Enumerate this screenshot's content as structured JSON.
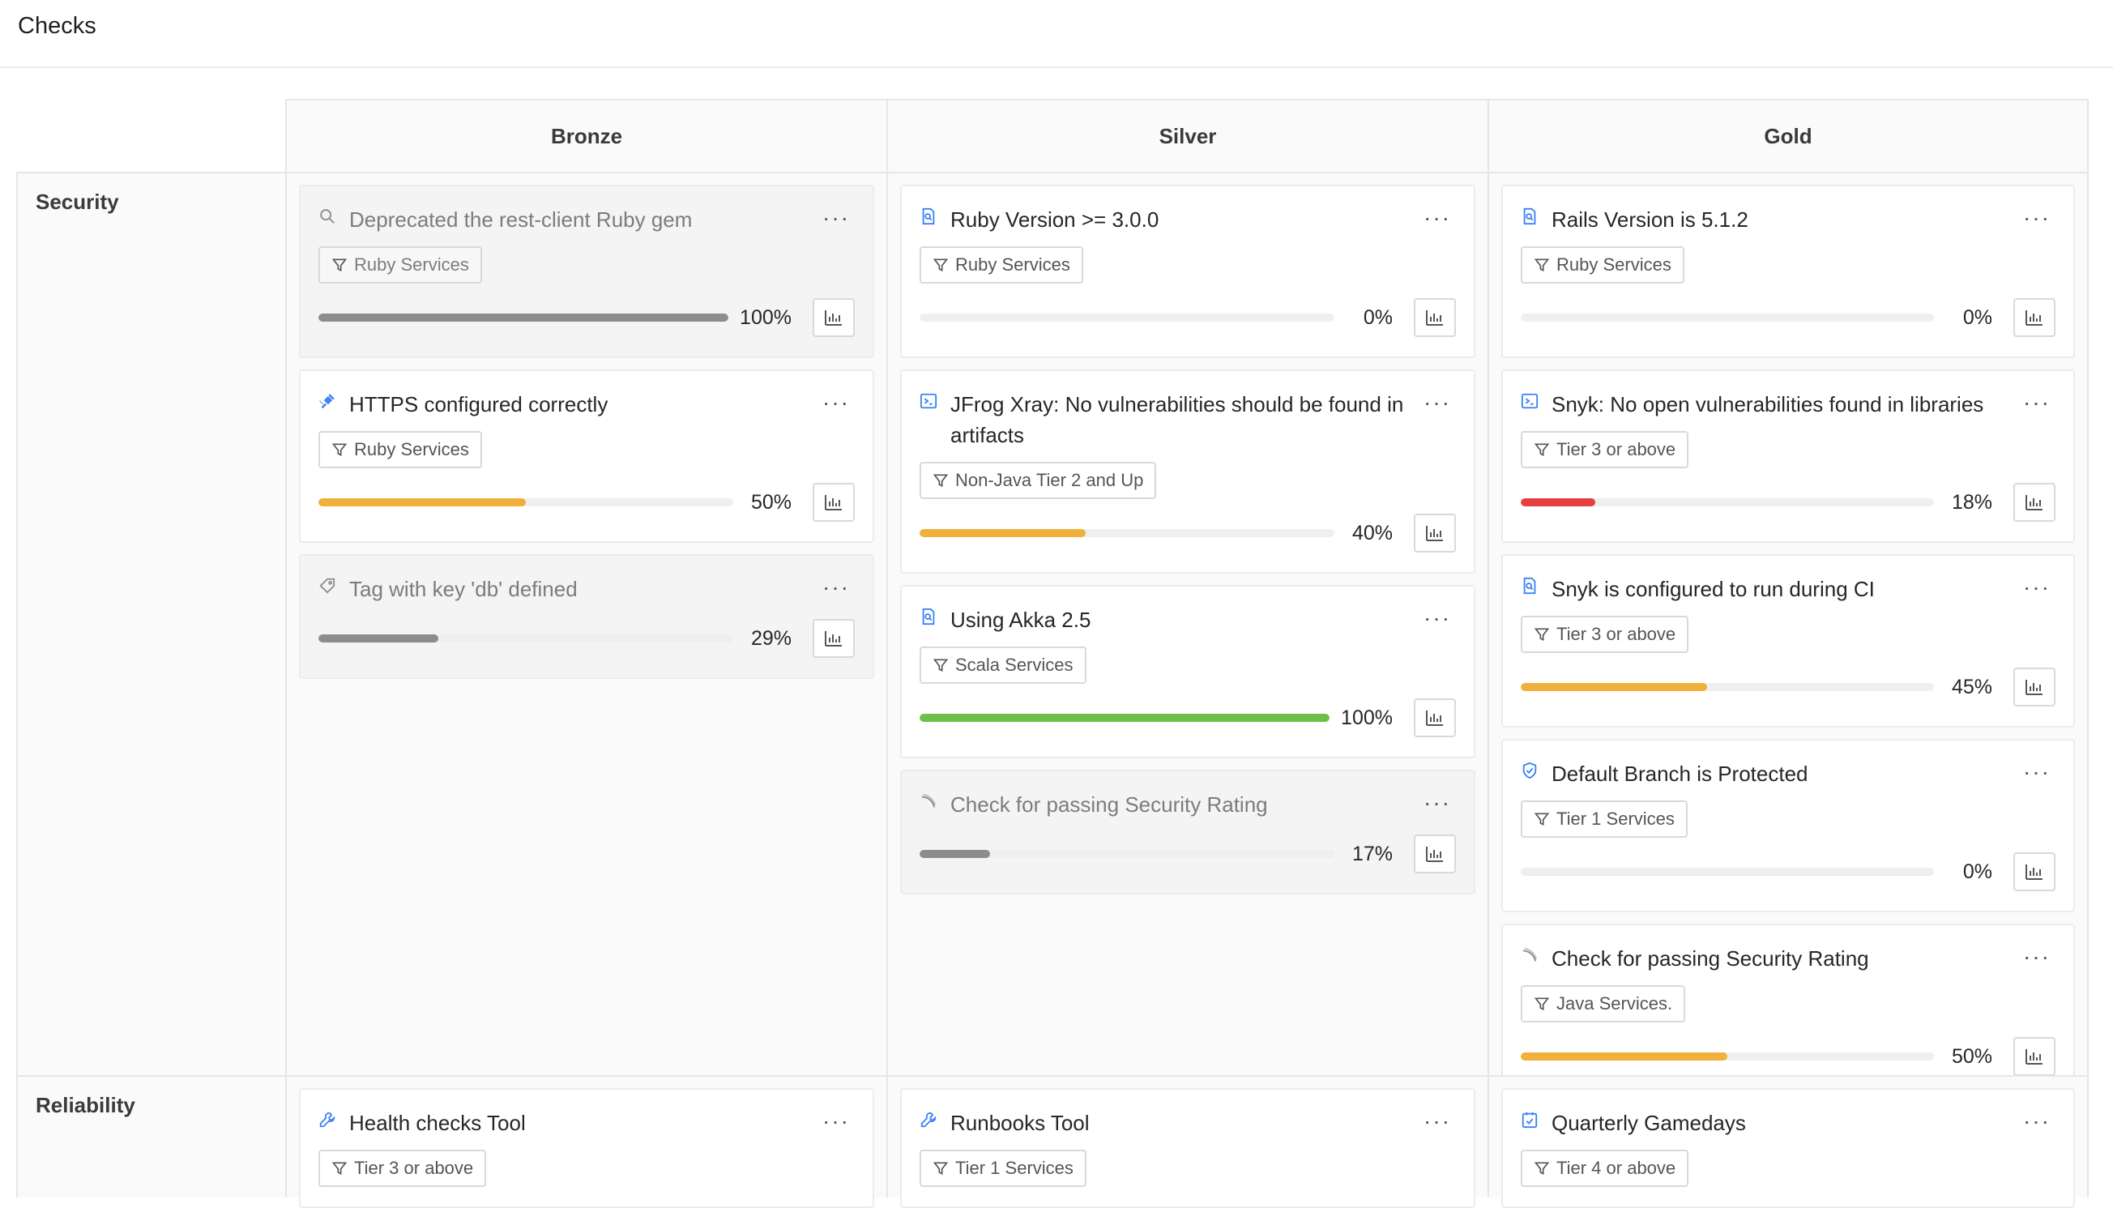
{
  "page": {
    "title": "Checks"
  },
  "colors": {
    "gray": "#8c8c8c",
    "orange": "#f0b13c",
    "green": "#6cc04a",
    "red": "#e64040",
    "blue": "#3b82f6"
  },
  "levels": [
    "Bronze",
    "Silver",
    "Gold"
  ],
  "categories": [
    {
      "name": "Security",
      "columns": [
        [
          {
            "title": "Deprecated the rest-client Ruby gem",
            "icon": "search-icon",
            "filter": "Ruby Services",
            "progress": 100,
            "pct_label": "100%",
            "bar_color": "gray",
            "disabled": true
          },
          {
            "title": "HTTPS configured correctly",
            "icon": "satellite-icon",
            "filter": "Ruby Services",
            "progress": 50,
            "pct_label": "50%",
            "bar_color": "orange",
            "disabled": false
          },
          {
            "title": "Tag with key 'db' defined",
            "icon": "tag-icon",
            "filter": null,
            "progress": 29,
            "pct_label": "29%",
            "bar_color": "gray",
            "disabled": true
          }
        ],
        [
          {
            "title": "Ruby Version >= 3.0.0",
            "icon": "file-search-icon",
            "filter": "Ruby Services",
            "progress": 0,
            "pct_label": "0%",
            "bar_color": "gray",
            "disabled": false
          },
          {
            "title": "JFrog Xray: No vulnerabilities should be found in artifacts",
            "icon": "terminal-icon",
            "filter": "Non-Java Tier 2 and Up",
            "progress": 40,
            "pct_label": "40%",
            "bar_color": "orange",
            "disabled": false
          },
          {
            "title": "Using Akka 2.5",
            "icon": "file-search-icon",
            "filter": "Scala Services",
            "progress": 100,
            "pct_label": "100%",
            "bar_color": "green",
            "disabled": false
          },
          {
            "title": "Check for passing Security Rating",
            "icon": "feather-icon",
            "filter": null,
            "progress": 17,
            "pct_label": "17%",
            "bar_color": "gray",
            "disabled": true
          }
        ],
        [
          {
            "title": "Rails Version is 5.1.2",
            "icon": "file-search-icon",
            "filter": "Ruby Services",
            "progress": 0,
            "pct_label": "0%",
            "bar_color": "gray",
            "disabled": false
          },
          {
            "title": "Snyk: No open vulnerabilities found in libraries",
            "icon": "terminal-icon",
            "filter": "Tier 3 or above",
            "progress": 18,
            "pct_label": "18%",
            "bar_color": "red",
            "disabled": false
          },
          {
            "title": "Snyk is configured to run during CI",
            "icon": "file-search-icon",
            "filter": "Tier 3 or above",
            "progress": 45,
            "pct_label": "45%",
            "bar_color": "orange",
            "disabled": false
          },
          {
            "title": "Default Branch is Protected",
            "icon": "shield-check-icon",
            "filter": "Tier 1 Services",
            "progress": 0,
            "pct_label": "0%",
            "bar_color": "gray",
            "disabled": false
          },
          {
            "title": "Check for passing Security Rating",
            "icon": "feather-icon",
            "filter": "Java Services.",
            "progress": 50,
            "pct_label": "50%",
            "bar_color": "orange",
            "disabled": false
          }
        ]
      ]
    },
    {
      "name": "Reliability",
      "columns": [
        [
          {
            "title": "Health checks Tool",
            "icon": "wrench-icon",
            "filter": "Tier 3 or above",
            "progress": null,
            "pct_label": null,
            "bar_color": "gray",
            "disabled": false
          }
        ],
        [
          {
            "title": "Runbooks Tool",
            "icon": "wrench-icon",
            "filter": "Tier 1 Services",
            "progress": null,
            "pct_label": null,
            "bar_color": "gray",
            "disabled": false
          }
        ],
        [
          {
            "title": "Quarterly Gamedays",
            "icon": "calendar-check-icon",
            "filter": "Tier 4 or above",
            "progress": null,
            "pct_label": null,
            "bar_color": "gray",
            "disabled": false
          }
        ]
      ]
    }
  ]
}
